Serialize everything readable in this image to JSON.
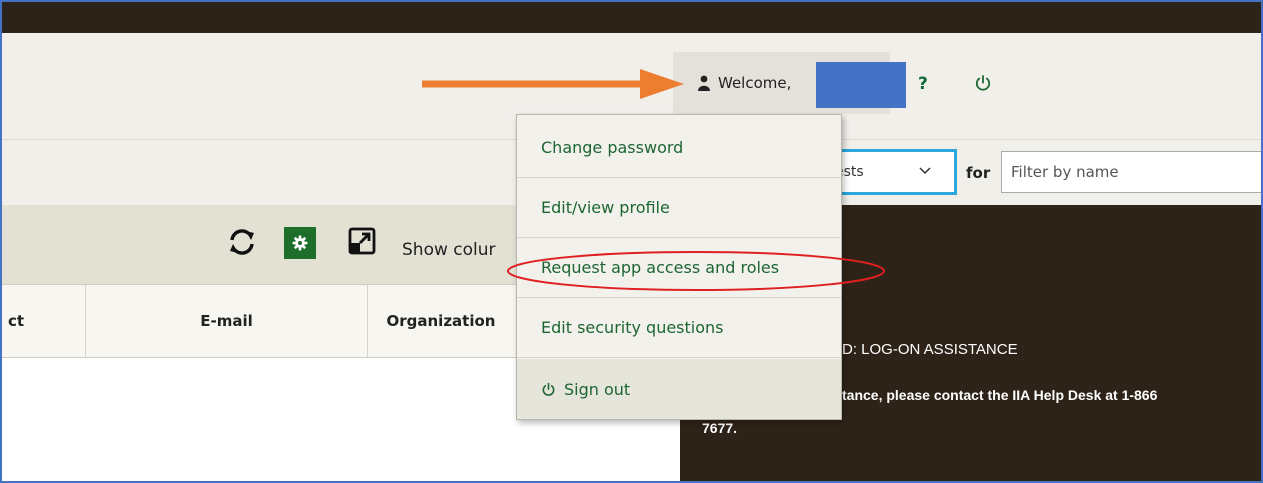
{
  "header": {
    "welcome_text": "Welcome,",
    "help_label": "?"
  },
  "filter": {
    "select_value": "ests",
    "for_label": "for",
    "search_placeholder": "Filter by name"
  },
  "toolbar": {
    "show_columns_label": "Show colur"
  },
  "table": {
    "columns": [
      "ct",
      "E-mail",
      "Organization"
    ]
  },
  "user_menu": {
    "items": [
      {
        "label": "Change password"
      },
      {
        "label": "Edit/view profile"
      },
      {
        "label": "Request app access and roles"
      },
      {
        "label": "Edit security questions"
      },
      {
        "label": "Sign out"
      }
    ]
  },
  "notice": {
    "title": "D: LOG-ON ASSISTANCE",
    "body_line1": "tance, please contact the IIA Help Desk at 1-866",
    "body_line2": "7677."
  },
  "annotations": {
    "arrow_color": "#ed7d31",
    "highlight_color": "#e02020",
    "redaction_color": "#4472c4"
  },
  "colors": {
    "topbar": "#2e2318",
    "menu_text": "#1d6633",
    "gear_button": "#1d6e2b",
    "select_border": "#2aa7dc"
  }
}
